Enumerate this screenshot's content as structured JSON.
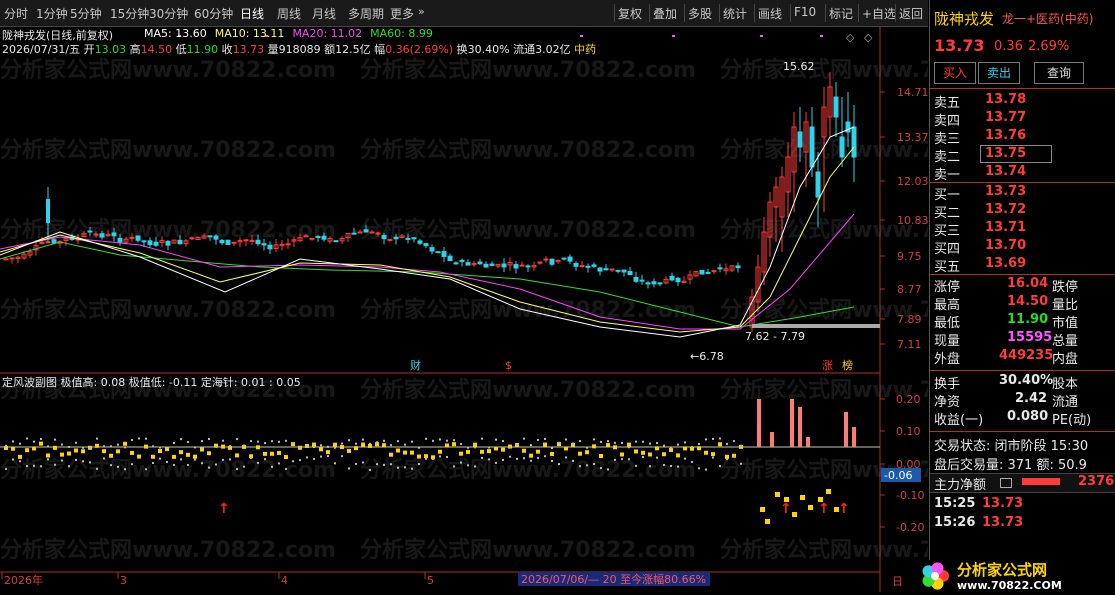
{
  "toolbar": {
    "periods": [
      "分时",
      "1分钟",
      "5分钟",
      "15分钟",
      "30分钟",
      "60分钟",
      "日线",
      "周线",
      "月线",
      "多周期",
      "更多"
    ],
    "active_period": "日线",
    "tools": [
      "复权",
      "叠加",
      "多股",
      "统计",
      "画线",
      "F10",
      "标记",
      "+自选",
      "返回"
    ]
  },
  "stock": {
    "name_line": "陇神戎发(日线,前复权)",
    "date": "2026/07/31/五",
    "open_label": "开",
    "open": "13.03",
    "high_label": "高",
    "high": "14.50",
    "low_label": "低",
    "low": "11.90",
    "close_label": "收",
    "close": "13.73",
    "volume_label": "量",
    "volume": "918089",
    "amount_label": "额",
    "amount": "12.5亿",
    "change_pct_label": "幅",
    "change_pct": "0.36(2.69%)",
    "turnover_label": "换",
    "turnover": "30.40%",
    "float_label": "流通",
    "float": "3.02亿",
    "sector": "中药"
  },
  "ma": [
    {
      "label": "MA5: 13.60",
      "color": "#ffffff"
    },
    {
      "label": "MA10: 13.11",
      "color": "#ffff66"
    },
    {
      "label": "MA20: 11.02",
      "color": "#ff44ff"
    },
    {
      "label": "MA60: 8.99",
      "color": "#33dd33"
    }
  ],
  "price_axis": [
    "14.71",
    "13.37",
    "12.03",
    "10.83",
    "9.75",
    "8.77",
    "7.89",
    "7.11"
  ],
  "annotations": {
    "high": "15.62",
    "low": "6.78",
    "range": "7.62 - 7.79"
  },
  "event_markers": [
    "财",
    "$",
    "涨",
    "榜"
  ],
  "indicator": {
    "name": "定风波副图",
    "params": "极值高: 0.08  极值低: -0.11  定海针: 0.01 : 0.05",
    "axis": [
      "0.20",
      "0.10",
      "0.00",
      "-0.10",
      "-0.20"
    ],
    "current": "-0.06"
  },
  "time_axis": [
    "2026年",
    "3",
    "4",
    "5"
  ],
  "range_summary": "2026/07/06/— 20 至今涨幅80.66%",
  "axis_corner": "日",
  "watermark": "分析家公式网www.70822.com",
  "right": {
    "title": "陇神戎发",
    "sub": "龙一+医药(中药)",
    "price": "13.73",
    "change": "0.36",
    "pct": "2.69%",
    "buttons": [
      "买入",
      "卖出",
      "查询"
    ],
    "asks": [
      {
        "label": "卖五",
        "price": "13.78"
      },
      {
        "label": "卖四",
        "price": "13.77"
      },
      {
        "label": "卖三",
        "price": "13.76"
      },
      {
        "label": "卖二",
        "price": "13.75"
      },
      {
        "label": "卖一",
        "price": "13.74"
      }
    ],
    "bids": [
      {
        "label": "买一",
        "price": "13.73"
      },
      {
        "label": "买二",
        "price": "13.72"
      },
      {
        "label": "买三",
        "price": "13.71"
      },
      {
        "label": "买四",
        "price": "13.70"
      },
      {
        "label": "买五",
        "price": "13.69"
      }
    ],
    "stats": [
      {
        "k": "涨停",
        "v": "16.04",
        "k2": "跌停"
      },
      {
        "k": "最高",
        "v": "14.50",
        "k2": "量比"
      },
      {
        "k": "最低",
        "v": "11.90",
        "k2": "市值"
      },
      {
        "k": "现量",
        "v": "15595",
        "k2": "总量"
      },
      {
        "k": "外盘",
        "v": "449235",
        "k2": "内盘"
      }
    ],
    "stats2": [
      {
        "k": "换手",
        "v": "30.40%",
        "k2": "股本"
      },
      {
        "k": "净资",
        "v": "2.42",
        "k2": "流通"
      },
      {
        "k": "收益(一)",
        "v": "0.080",
        "k2": "PE(动)"
      }
    ],
    "trade_status": "交易状态: 闭市阶段 15:30",
    "after_hours": "盘后交易量: 371  额: 50.9",
    "main_flow_label": "主力净额",
    "main_flow_value": "2376",
    "ticks": [
      {
        "time": "15:25",
        "price": "13.73"
      },
      {
        "time": "15:26",
        "price": "13.73"
      }
    ],
    "logo_text": "分析家公式网",
    "logo_url": "www.70822.COM"
  }
}
